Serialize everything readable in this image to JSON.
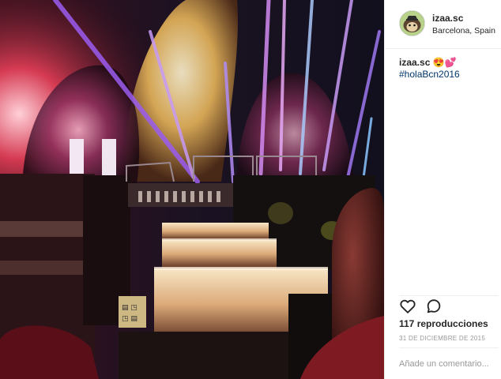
{
  "post": {
    "username": "izaa.sc",
    "location": "Barcelona, Spain",
    "caption_emojis": "😍💕",
    "hashtag": "#holaBcn2016",
    "views": "117 reproducciones",
    "date": "31 DE DICIEMBRE DE 2015"
  },
  "comment": {
    "placeholder": "Añade un comentario..."
  },
  "media": {
    "sign_text": "▤ ◳\n◳ ▤"
  },
  "icons": {
    "like": "heart-outline-icon",
    "comment": "speech-bubble-icon"
  },
  "colors": {
    "hashtag": "#003569",
    "text": "#262626",
    "muted": "#999999",
    "divider": "#efefef"
  }
}
